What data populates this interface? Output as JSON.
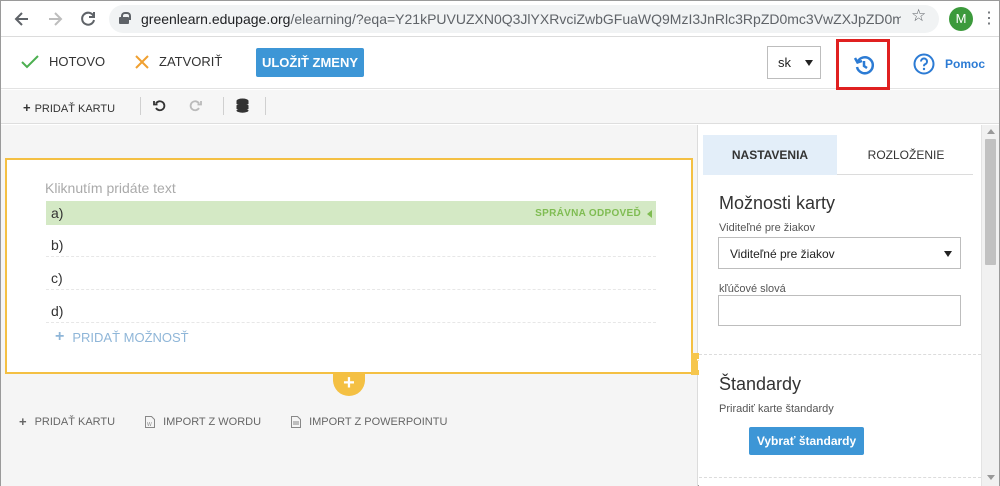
{
  "browser": {
    "back_icon": "arrow-left-icon",
    "forward_icon": "arrow-right-icon",
    "reload_icon": "reload-icon",
    "url_host": "greenlearn.edupage.org",
    "url_path": "/elearning/?eqa=Y21kPUVUZXN0Q3JlYXRvciZwbGFuaWQ9MzI3JnRlc3RpZD0mc3VwZXJpZD0mY...",
    "avatar_letter": "M"
  },
  "toolbar": {
    "done_label": "HOTOVO",
    "close_label": "ZATVORIŤ",
    "save_label": "ULOŽIŤ ZMENY",
    "language_value": "sk",
    "help_label": "Pomoc",
    "colors": {
      "primary": "#3d96d6",
      "done_check": "#4caf50",
      "close_x": "#f0a030",
      "highlight": "#e02020"
    }
  },
  "subtoolbar": {
    "add_card_label": "PRIDAŤ KARTU"
  },
  "card": {
    "placeholder": "Kliknutím pridáte text",
    "options": [
      {
        "label": "a)",
        "correct": true
      },
      {
        "label": "b)",
        "correct": false
      },
      {
        "label": "c)",
        "correct": false
      },
      {
        "label": "d)",
        "correct": false
      }
    ],
    "correct_tag": "SPRÁVNA ODPOVEĎ",
    "add_option_label": "PRIDAŤ MOŽNOSŤ"
  },
  "bottom_actions": {
    "add_card": "PRIDAŤ KARTU",
    "import_word": "IMPORT Z WORDU",
    "import_ppt": "IMPORT Z POWERPOINTU"
  },
  "panel": {
    "tabs": [
      {
        "label": "NASTAVENIA",
        "active": true
      },
      {
        "label": "ROZLOŽENIE",
        "active": false
      }
    ],
    "card_options_title": "Možnosti karty",
    "visibility_label": "Viditeľné pre žiakov",
    "visibility_value": "Viditeľné pre žiakov",
    "keywords_label": "kľúčové slová",
    "keywords_value": "",
    "standards_title": "Štandardy",
    "standards_label": "Priradiť karte štandardy",
    "standards_button": "Vybrať štandardy"
  }
}
